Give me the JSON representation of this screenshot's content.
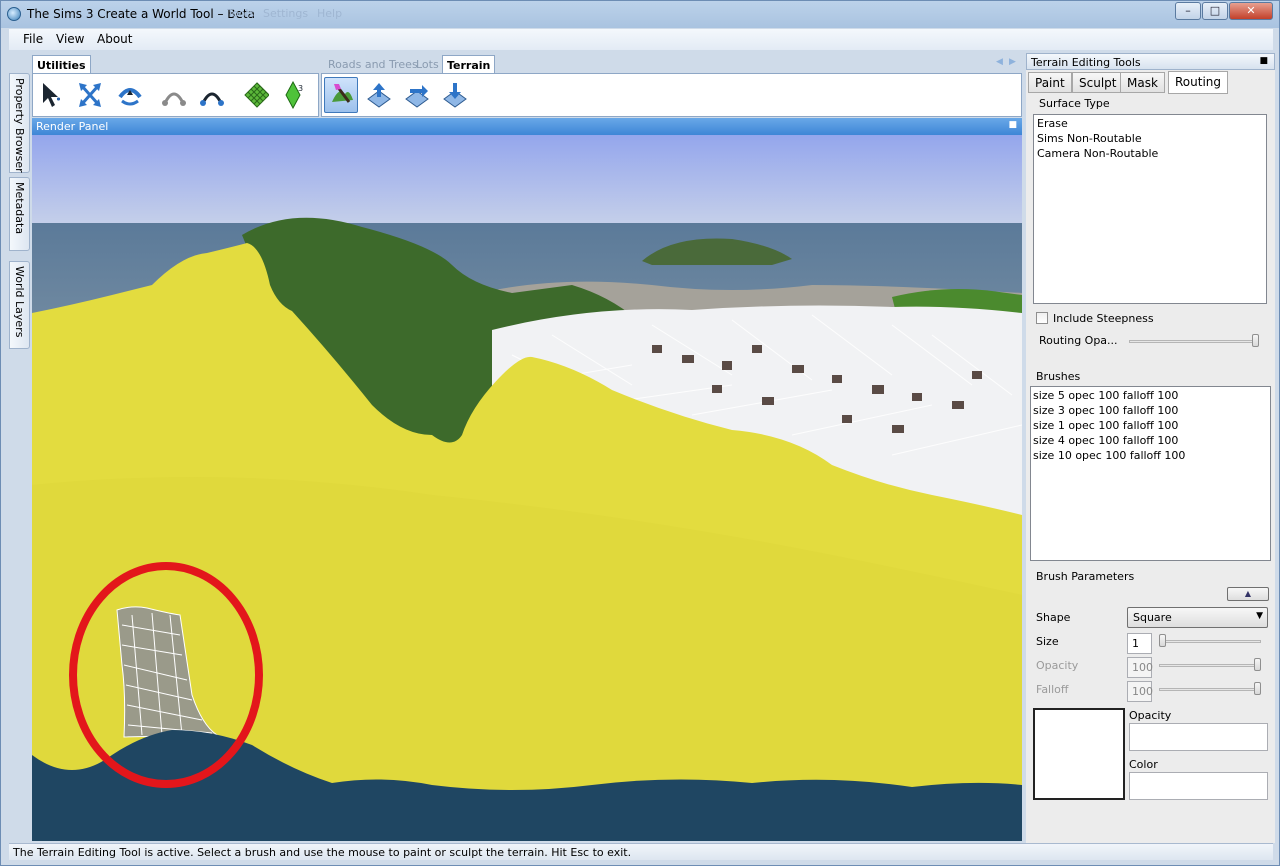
{
  "window": {
    "title": "The Sims 3 Create a World Tool – Beta",
    "title_bg_menu_faint": [
      "Tools",
      "Settings",
      "Help"
    ]
  },
  "menu": {
    "items": [
      "File",
      "View",
      "About"
    ]
  },
  "side_tabs": [
    "Property Browser",
    "Metadata",
    "World Layers"
  ],
  "toolbars": {
    "utilities_label": "Utilities",
    "roads_label": "Roads and Trees",
    "lots_label": "Lots",
    "terrain_label": "Terrain"
  },
  "render_panel": {
    "title": "Render Panel"
  },
  "terrain_tools": {
    "header": "Terrain Editing Tools",
    "tabs": [
      "Paint",
      "Sculpt",
      "Mask",
      "Routing"
    ],
    "active_tab": "Routing",
    "surface_type_label": "Surface Type",
    "surface_types": [
      "Erase",
      "Sims Non-Routable",
      "Camera Non-Routable"
    ],
    "include_steepness_label": "Include Steepness",
    "routing_opacity_label": "Routing Opa...",
    "brushes_label": "Brushes",
    "brushes": [
      "size 5  opec 100  falloff 100",
      "size 3  opec 100  falloff 100",
      "size 1  opec 100  falloff 100",
      "size 4  opec 100  falloff 100",
      "size 10  opec 100  falloff 100"
    ],
    "brush_params_label": "Brush Parameters",
    "shape_label": "Shape",
    "shape_value": "Square",
    "size_label": "Size",
    "size_value": "1",
    "opacity_label": "Opacity",
    "opacity_value": "100",
    "falloff_label": "Falloff",
    "falloff_value": "100",
    "opacity_field_label": "Opacity",
    "color_field_label": "Color"
  },
  "status": {
    "text": "The Terrain Editing Tool is active. Select a brush and use the mouse to paint or sculpt the terrain. Hit Esc to exit."
  },
  "colors": {
    "terrain_yellow": "#e3dc3f",
    "water_dark": "#1f4662",
    "highlight_circle": "#e3161b",
    "sky_top": "#93a8ec"
  }
}
